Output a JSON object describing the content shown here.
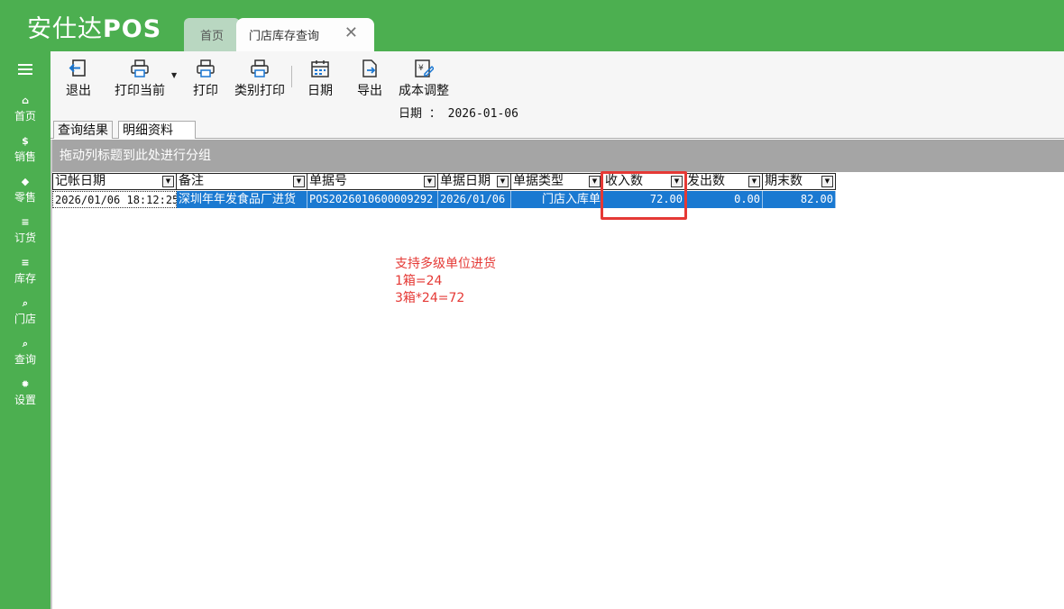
{
  "app": {
    "brand_cn": "安仕达",
    "brand_en": "POS"
  },
  "tabs": {
    "home": "首页",
    "active": "门店库存查询",
    "close_symbol": "✕"
  },
  "sidebar": {
    "items": [
      {
        "label": "首页",
        "icon": "home-icon",
        "glyph": "⌂"
      },
      {
        "label": "销售",
        "icon": "currency-icon",
        "glyph": "$"
      },
      {
        "label": "零售",
        "icon": "tag-icon",
        "glyph": "◆"
      },
      {
        "label": "订货",
        "icon": "database-icon",
        "glyph": "≡"
      },
      {
        "label": "库存",
        "icon": "database-icon",
        "glyph": "≡"
      },
      {
        "label": "门店",
        "icon": "search-icon",
        "glyph": "⌕"
      },
      {
        "label": "查询",
        "icon": "search-icon",
        "glyph": "⌕"
      },
      {
        "label": "设置",
        "icon": "gear-icon",
        "glyph": "✹"
      }
    ]
  },
  "toolbar": {
    "exit": "退出",
    "print_current": "打印当前",
    "print": "打印",
    "category_print": "类别打印",
    "date": "日期",
    "export": "导出",
    "cost_adjust": "成本调整"
  },
  "date_line": "日期 ： 2026-01-06",
  "subtabs": {
    "query_result": "查询结果",
    "detail": "明细资料"
  },
  "group_hint": "拖动列标题到此处进行分组",
  "grid": {
    "columns": [
      "记帐日期",
      "备注",
      "单据号",
      "单据日期",
      "单据类型",
      "收入数",
      "发出数",
      "期末数"
    ],
    "rows": [
      [
        "2026/01/06 18:12:25",
        "深圳年年发食品厂进货",
        "POS2026010600009292",
        "2026/01/06",
        "门店入库单",
        "72.00",
        "0.00",
        "82.00"
      ]
    ]
  },
  "annotation": {
    "line1": "支持多级单位进货",
    "line2": "1箱=24",
    "line3": "3箱*24=72",
    "color": "#e53935"
  },
  "colors": {
    "brand_green": "#4caf50",
    "selection_blue": "#1a79d1"
  }
}
